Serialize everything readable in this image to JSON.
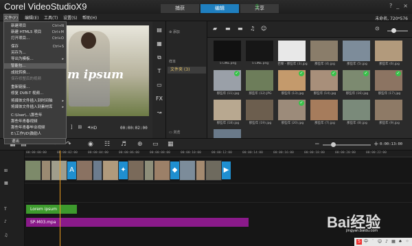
{
  "app": {
    "logo": "Corel VideoStudioX9",
    "steps": [
      "捕获",
      "编辑",
      "共享"
    ],
    "active_step": "编辑",
    "window_buttons": [
      "?",
      "_",
      "×"
    ]
  },
  "menubar": {
    "items": [
      "文件(F)",
      "编辑(E)",
      "工具(T)",
      "设置(S)",
      "帮助(H)"
    ],
    "project_info": "未命名, 720*576"
  },
  "file_menu": {
    "items": [
      {
        "label": "新建项目",
        "shortcut": "Ctrl+N"
      },
      {
        "label": "新建 HTML5 项目",
        "shortcut": "Ctrl+M"
      },
      {
        "label": "打开项目...",
        "shortcut": "Ctrl+O"
      },
      {
        "label": "保存",
        "shortcut": "Ctrl+S"
      },
      {
        "label": "另存为..."
      },
      {
        "label": "导出为模板..."
      },
      {
        "label": "智能包..."
      },
      {
        "label": "成批转换..."
      },
      {
        "label": "保存修整后的视频",
        "disabled": true
      },
      {
        "label": "重新链接..."
      },
      {
        "label": "修复 DVB-T 视频..."
      },
      {
        "label": "将媒体文件插入到时间轴",
        "submenu": true
      },
      {
        "label": "将媒体文件插入到素材库",
        "submenu": true
      },
      {
        "label": "C:\\User\\...\\那些年"
      },
      {
        "label": "那些年青春视频"
      },
      {
        "label": "那些年青春毕业视频"
      },
      {
        "label": "E:\\工作\\ID\\鼓励人"
      },
      {
        "label": "退出"
      }
    ]
  },
  "player": {
    "overlay_text": "m ipsum",
    "hd_label": "HD",
    "timecode": "00:00:02:00",
    "controls": [
      "[",
      "]",
      "⊞",
      "◂"
    ]
  },
  "library": {
    "add_label": "添加",
    "browse_label": "浏览",
    "header_label": "样本",
    "folder_label": "文件夹 (3)",
    "thumbs": [
      {
        "caption": "5 LINE.png",
        "color": "#111111",
        "checked": false
      },
      {
        "caption": "5 LINE.png",
        "color": "#161616",
        "checked": false
      },
      {
        "caption": "巴黎 - 那些年 (3).jpg",
        "color": "#e8e8e8",
        "checked": false
      },
      {
        "caption": "那些年 (4).jpg",
        "color": "#8a7d6a",
        "checked": false
      },
      {
        "caption": "那些年 (5).jpg",
        "color": "#7d8c9a",
        "checked": false
      },
      {
        "caption": "那些年 (6).jpg",
        "color": "#b29a7c",
        "checked": false
      },
      {
        "caption": "那些年 (11).jpg",
        "color": "#9aa0a8",
        "checked": true
      },
      {
        "caption": "那些年 (12).JPG",
        "color": "#6d7d5a",
        "checked": false
      },
      {
        "caption": "那些年 (13).jpg",
        "color": "#c49a6c",
        "checked": true
      },
      {
        "caption": "那些年 (14).jpg",
        "color": "#a88f7a",
        "checked": true
      },
      {
        "caption": "那些年 (16).jpg",
        "color": "#7c8a70",
        "checked": true
      },
      {
        "caption": "那些年 (17).jpg",
        "color": "#8c7462",
        "checked": true
      },
      {
        "caption": "那些年 (18).jpg",
        "color": "#b8a890",
        "checked": false
      },
      {
        "caption": "那些年 (19).jpg",
        "color": "#6c5e4e",
        "checked": false
      },
      {
        "caption": "那些年 (20).jpg",
        "color": "#9c8b7a",
        "checked": true
      },
      {
        "caption": "那些年 (7).jpg",
        "color": "#a67c5c",
        "checked": false
      },
      {
        "caption": "那些年 (8).jpg",
        "color": "#7a8a7a",
        "checked": false
      },
      {
        "caption": "那些年 (9).jpg",
        "color": "#8e7a66",
        "checked": false
      },
      {
        "caption": "那些年 (10).jpg",
        "color": "#6a7a8a",
        "checked": false
      }
    ]
  },
  "timeline": {
    "ruler_ticks": [
      "00:00:00:00",
      "00:00:02:00",
      "00:00:04:00",
      "00:00:06:00",
      "00:00:08:00",
      "00:00:10:00",
      "00:00:12:00",
      "00:00:14:00",
      "00:00:16:00",
      "00:00:18:00",
      "00:00:20:00",
      "00:00:22:00"
    ],
    "total_time": "0:00:13:00",
    "title_clip": "Lorem ipsum",
    "audio_clip": "SP-M03.mpa"
  },
  "watermark": {
    "text": "Bai经验",
    "url": "jingyan.baidu.com"
  },
  "colors": {
    "accent": "#1f7fbf",
    "title_clip": "#3d9a2d",
    "audio_clip": "#8a1a8a",
    "playhead": "#f0a020"
  }
}
